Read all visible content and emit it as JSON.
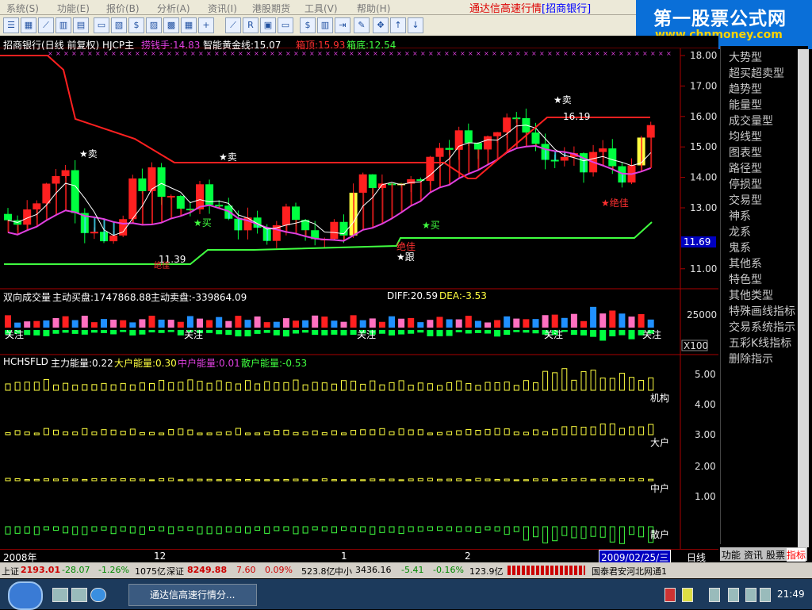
{
  "menu": {
    "items": [
      "系统(S)",
      "功能(E)",
      "报价(B)",
      "分析(A)",
      "资讯(I)",
      "港股期货",
      "工具(V)",
      "帮助(H)"
    ]
  },
  "app_title": "通达信高速行情",
  "stock_tag": "[招商银行]",
  "banner": {
    "title": "第一股票公式网",
    "url": "www.chnmoney.com"
  },
  "main_panel": {
    "title": "招商银行(日线 前复权) HJCP主",
    "indicators": [
      {
        "label": "捞钱手:14.83",
        "color": "#e040e0"
      },
      {
        "label": "智能黄金线:15.07",
        "color": "#ffffff"
      },
      {
        "label": "箱顶:15.93",
        "color": "#ff3030"
      },
      {
        "label": "箱底:12.54",
        "color": "#40ff40"
      }
    ],
    "price_ticks": [
      "18.00",
      "17.00",
      "16.00",
      "15.00",
      "14.00",
      "13.00",
      "11.00"
    ],
    "current_price": "11.69",
    "labels": {
      "sell": "★卖",
      "buy": "★买",
      "follow": "★跟",
      "best": "★绝佳",
      "high": "16.19",
      "low": "11.39",
      "best2": "绝佳"
    }
  },
  "volume_panel": {
    "title": "双向成交量",
    "buy_label": "主动买盘:1747868.88",
    "sell_label": "主动卖盘:-339864.09",
    "diff": "DIFF:20.59",
    "dea": "DEA:-3.53",
    "tick": "25000",
    "unit": "X100",
    "watch": "关注"
  },
  "energy_panel": {
    "title": "HCHSFLD",
    "main": "主力能量:0.22",
    "big": "大户能量:0.30",
    "mid": "中户能量:0.01",
    "small": "散户能量:-0.53",
    "ticks": [
      "5.00",
      "4.00",
      "3.00",
      "2.00",
      "1.00"
    ],
    "rows": [
      "机构",
      "大户",
      "中户",
      "散户"
    ]
  },
  "sidebar": {
    "items": [
      "大势型",
      "超买超卖型",
      "趋势型",
      "能量型",
      "成交量型",
      "均线型",
      "图表型",
      "路径型",
      "停损型",
      "交易型",
      "神系",
      "龙系",
      "鬼系",
      "其他系",
      "特色型",
      "其他类型",
      "特殊画线指标",
      "交易系统指示",
      "五彩K线指标",
      "删除指示"
    ]
  },
  "sidebar_tabs": [
    "功能",
    "资讯",
    "股票",
    "指标"
  ],
  "date_axis": {
    "labels": [
      "2008年",
      "12",
      "1",
      "2"
    ],
    "current_date": "2009/02/25/三",
    "period": "日线"
  },
  "status": {
    "sh_label": "上证",
    "sh_value": "2193.01",
    "sh_change": "-28.07",
    "sh_pct": "-1.26%",
    "sh_amount": "1075亿",
    "sz_label": "深证",
    "sz_value": "8249.88",
    "sz_change": "7.60",
    "sz_pct": "0.09%",
    "sz_amount": "523.8亿",
    "zx_label": "中小",
    "zx_value": "3436.16",
    "zx_change": "-5.41",
    "zx_pct": "-0.16%",
    "zx_amount": "123.9亿",
    "broker": "国泰君安河北网通1"
  },
  "taskbar": {
    "app": "通达信高速行情分...",
    "time": "21:49"
  },
  "colors": {
    "up": "#ff2020",
    "down": "#00ff40",
    "yellow": "#ffff40",
    "magenta": "#e040e0",
    "cyan": "#40e0ff",
    "blue": "#2090ff",
    "pink": "#ff70c0"
  }
}
